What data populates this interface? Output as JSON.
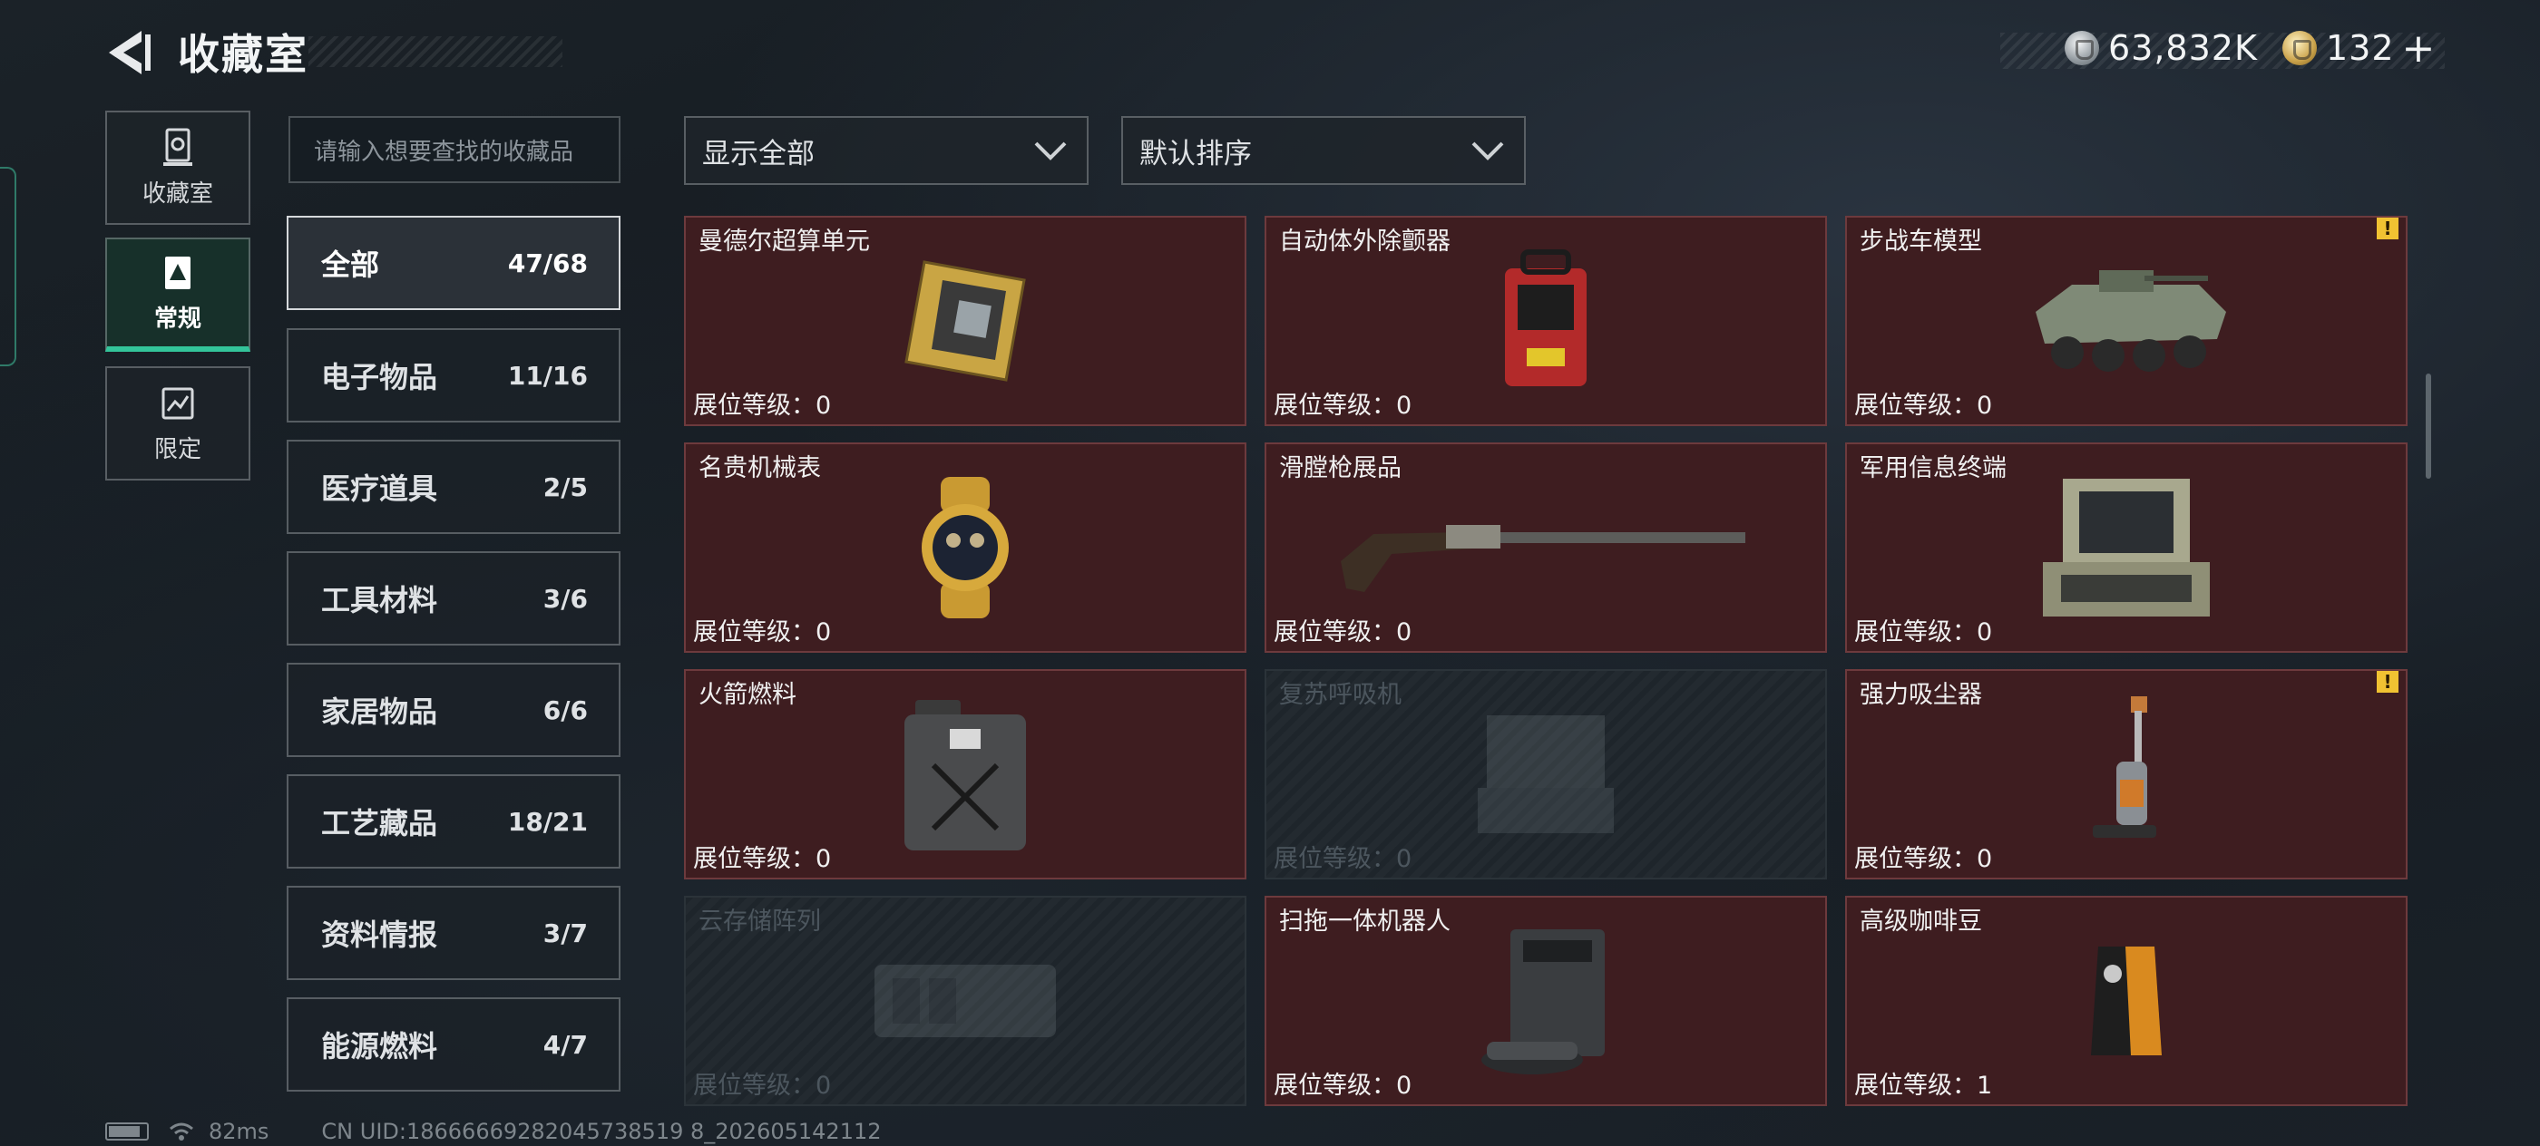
{
  "header": {
    "title": "收藏室",
    "currency_silver": "63,832K",
    "currency_gold": "132",
    "plus_label": "+"
  },
  "nav": [
    {
      "label": "收藏室",
      "icon": "trophy-case-icon"
    },
    {
      "label": "常规",
      "icon": "regular-collection-icon",
      "active": true
    },
    {
      "label": "限定",
      "icon": "limited-collection-icon"
    }
  ],
  "search": {
    "placeholder": "请输入想要查找的收藏品"
  },
  "categories": [
    {
      "name": "全部",
      "count": "47/68",
      "active": true
    },
    {
      "name": "电子物品",
      "count": "11/16"
    },
    {
      "name": "医疗道具",
      "count": "2/5"
    },
    {
      "name": "工具材料",
      "count": "3/6"
    },
    {
      "name": "家居物品",
      "count": "6/6"
    },
    {
      "name": "工艺藏品",
      "count": "18/21"
    },
    {
      "name": "资料情报",
      "count": "3/7"
    },
    {
      "name": "能源燃料",
      "count": "4/7"
    }
  ],
  "filters": {
    "display": "显示全部",
    "sort": "默认排序"
  },
  "items": [
    {
      "name": "曼德尔超算单元",
      "level": "展位等级：0",
      "icon": "supercomputer-unit-icon",
      "locked": false,
      "alert": false
    },
    {
      "name": "自动体外除颤器",
      "level": "展位等级：0",
      "icon": "defibrillator-icon",
      "locked": false,
      "alert": false
    },
    {
      "name": "步战车模型",
      "level": "展位等级：0",
      "icon": "ifv-model-icon",
      "locked": false,
      "alert": true
    },
    {
      "name": "名贵机械表",
      "level": "展位等级：0",
      "icon": "watch-icon",
      "locked": false,
      "alert": false
    },
    {
      "name": "滑膛枪展品",
      "level": "展位等级：0",
      "icon": "musket-icon",
      "locked": false,
      "alert": false
    },
    {
      "name": "军用信息终端",
      "level": "展位等级：0",
      "icon": "military-terminal-icon",
      "locked": false,
      "alert": false
    },
    {
      "name": "火箭燃料",
      "level": "展位等级：0",
      "icon": "fuel-can-icon",
      "locked": false,
      "alert": false
    },
    {
      "name": "复苏呼吸机",
      "level": "展位等级：0",
      "icon": "ventilator-icon",
      "locked": true,
      "alert": false
    },
    {
      "name": "强力吸尘器",
      "level": "展位等级：0",
      "icon": "vacuum-cleaner-icon",
      "locked": false,
      "alert": true
    },
    {
      "name": "云存储阵列",
      "level": "展位等级：0",
      "icon": "storage-array-icon",
      "locked": true,
      "alert": false
    },
    {
      "name": "扫拖一体机器人",
      "level": "展位等级：0",
      "icon": "robot-vacuum-icon",
      "locked": false,
      "alert": false
    },
    {
      "name": "高级咖啡豆",
      "level": "展位等级：1",
      "icon": "coffee-bag-icon",
      "locked": false,
      "alert": false
    }
  ],
  "alert_mark": "!",
  "status_bar": {
    "ping": "82ms",
    "uid": "CN UID:18666669282045738519 8_202605142112"
  }
}
